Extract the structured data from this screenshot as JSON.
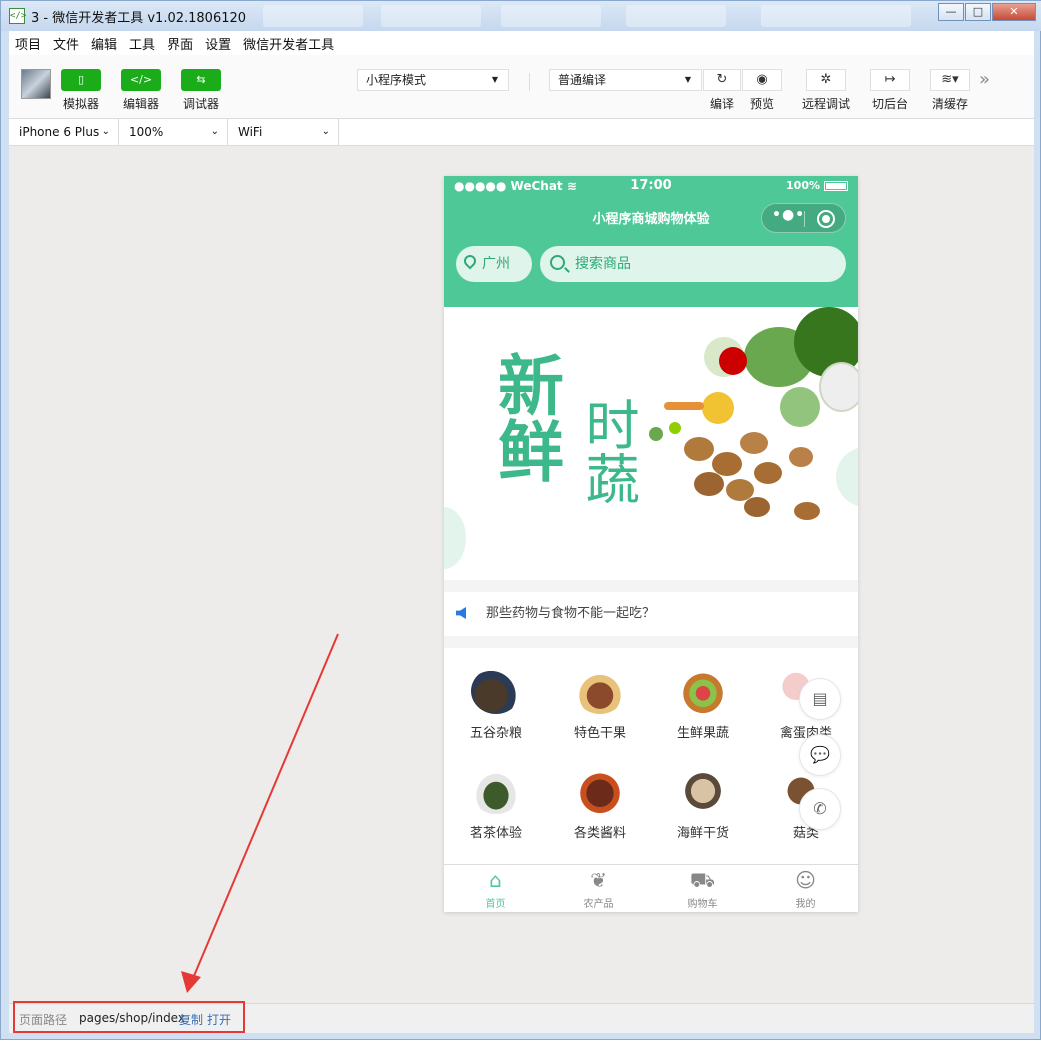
{
  "window": {
    "title": "3 - 微信开发者工具 v1.02.1806120",
    "min": "—",
    "max": "□",
    "close": "✕"
  },
  "menu": [
    "项目",
    "文件",
    "编辑",
    "工具",
    "界面",
    "设置",
    "微信开发者工具"
  ],
  "toolbar": {
    "simulator": "模拟器",
    "editor": "编辑器",
    "debugger": "调试器",
    "mode": "小程序模式",
    "compile_mode": "普通编译",
    "compile": "编译",
    "preview": "预览",
    "remote_debug": "远程调试",
    "background": "切后台",
    "clear_cache": "清缓存",
    "more": "»"
  },
  "device": {
    "model": "iPhone 6 Plus",
    "zoom": "100%",
    "network": "WiFi"
  },
  "phone": {
    "status_left": "●●●●● WeChat ≋",
    "time": "17:00",
    "battery": "100%",
    "page_title": "小程序商城购物体验",
    "city": "广州",
    "search_placeholder": "搜索商品",
    "banner_line1": "新鲜",
    "banner_line2": "时蔬",
    "notice": "那些药物与食物不能一起吃？",
    "categories": [
      "五谷杂粮",
      "特色干果",
      "生鲜果蔬",
      "禽蛋肉类",
      "茗茶体验",
      "各类酱料",
      "海鲜干货",
      "菇类"
    ],
    "tabs": [
      "首页",
      "农产品",
      "购物车",
      "我的"
    ]
  },
  "status": {
    "path_label": "页面路径",
    "path": "pages/shop/index",
    "copy": "复制",
    "open": "打开"
  },
  "colors": {
    "brand_green": "#4fc898",
    "wechat_green": "#1aad19",
    "highlight_red": "#e53935"
  }
}
